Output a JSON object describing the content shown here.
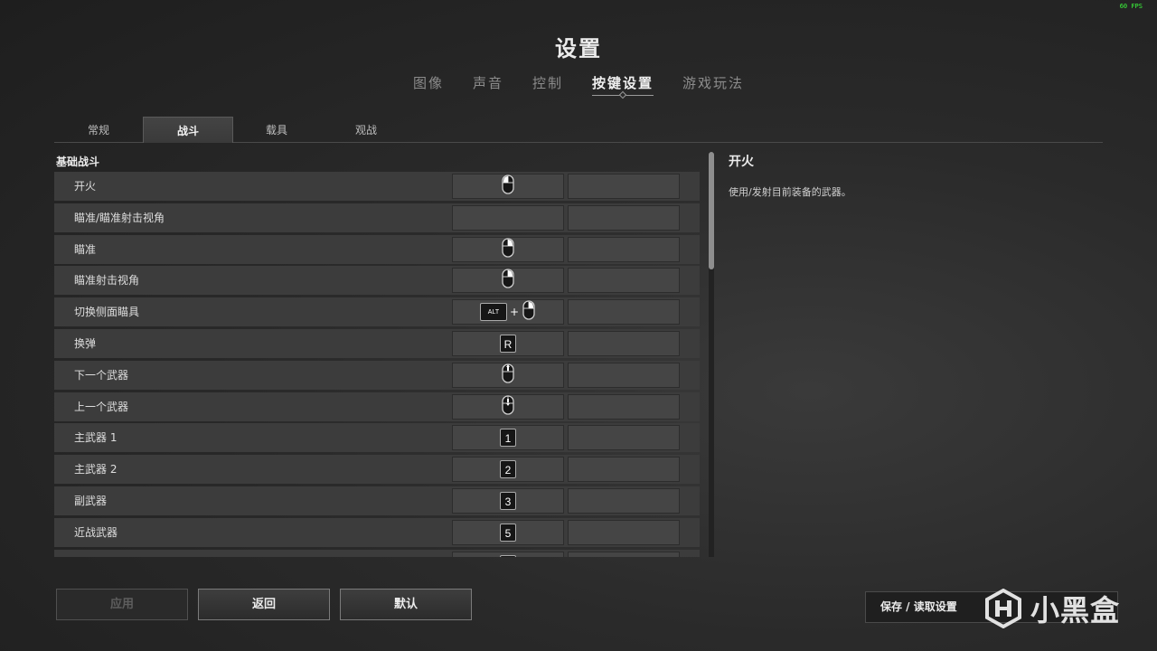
{
  "fps": "60 FPS",
  "title": "设置",
  "main_tabs": [
    {
      "label": "图像"
    },
    {
      "label": "声音"
    },
    {
      "label": "控制"
    },
    {
      "label": "按键设置",
      "active": true
    },
    {
      "label": "游戏玩法"
    }
  ],
  "sub_tabs": [
    {
      "label": "常规"
    },
    {
      "label": "战斗",
      "active": true
    },
    {
      "label": "载具"
    },
    {
      "label": "观战"
    }
  ],
  "section_title": "基础战斗",
  "bindings": [
    {
      "label": "开火",
      "primary": {
        "type": "mouse",
        "icon": "mouse-left-click-icon"
      },
      "secondary": ""
    },
    {
      "label": "瞄准/瞄准射击视角",
      "primary": {
        "type": "none"
      },
      "secondary": ""
    },
    {
      "label": "瞄准",
      "primary": {
        "type": "mouse",
        "icon": "mouse-right-click-icon"
      },
      "secondary": ""
    },
    {
      "label": "瞄准射击视角",
      "primary": {
        "type": "mouse",
        "icon": "mouse-right-click-icon"
      },
      "secondary": ""
    },
    {
      "label": "切换侧面瞄具",
      "primary": {
        "type": "combo",
        "key": "ALT",
        "icon": "mouse-right-click-icon"
      },
      "secondary": ""
    },
    {
      "label": "换弹",
      "primary": {
        "type": "key",
        "key": "R"
      },
      "secondary": ""
    },
    {
      "label": "下一个武器",
      "primary": {
        "type": "mouse",
        "icon": "mouse-wheel-up-icon"
      },
      "secondary": ""
    },
    {
      "label": "上一个武器",
      "primary": {
        "type": "mouse",
        "icon": "mouse-wheel-down-icon"
      },
      "secondary": ""
    },
    {
      "label": "主武器 1",
      "primary": {
        "type": "key",
        "key": "1"
      },
      "secondary": ""
    },
    {
      "label": "主武器 2",
      "primary": {
        "type": "key",
        "key": "2"
      },
      "secondary": ""
    },
    {
      "label": "副武器",
      "primary": {
        "type": "key",
        "key": "3"
      },
      "secondary": ""
    },
    {
      "label": "近战武器",
      "primary": {
        "type": "key",
        "key": "5"
      },
      "secondary": ""
    },
    {
      "label": "",
      "primary": {
        "type": "key",
        "key": ""
      },
      "secondary": ""
    }
  ],
  "scroll_fraction": 0.29,
  "description": {
    "title": "开火",
    "text": "使用/发射目前装备的武器。"
  },
  "buttons": {
    "apply": "应用",
    "back": "返回",
    "default": "默认",
    "save_load": "保存 / 读取设置"
  },
  "watermark": "小黑盒",
  "colors": {
    "accent_text": "#f0f0f0",
    "fps": "#3cff3c"
  }
}
